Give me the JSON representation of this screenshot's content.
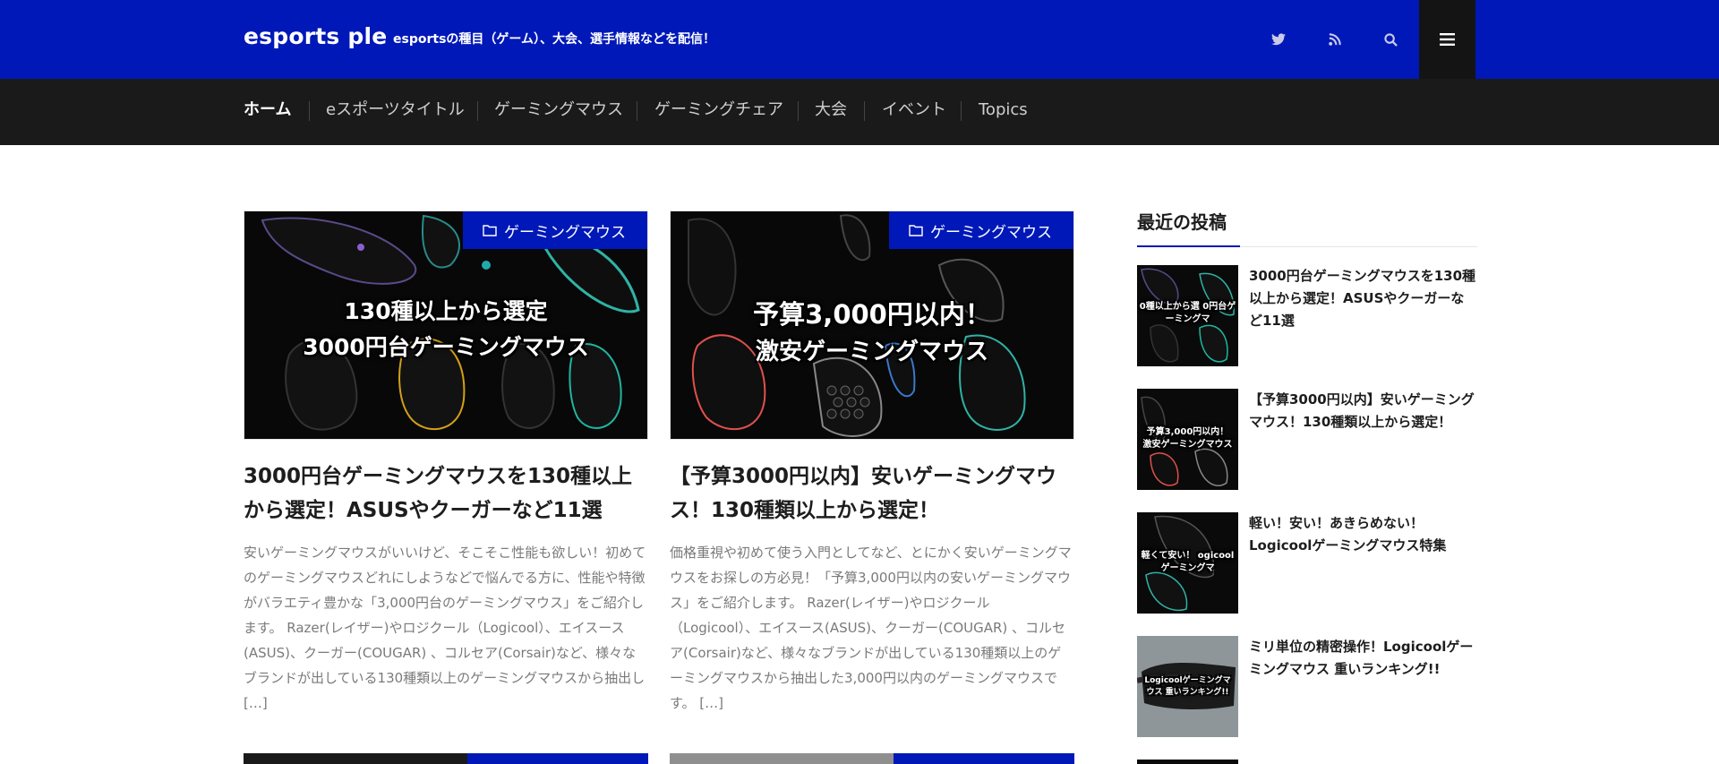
{
  "header": {
    "logo": "esports ple",
    "tagline": "esportsの種目（ゲーム）、大会、選手情報などを配信！",
    "icons": [
      "twitter-icon",
      "rss-icon",
      "search-icon",
      "menu-icon"
    ]
  },
  "nav": {
    "items": [
      {
        "label": "ホーム"
      },
      {
        "label": "eスポーツタイトル"
      },
      {
        "label": "ゲーミングマウス"
      },
      {
        "label": "ゲーミングチェア"
      },
      {
        "label": "大会"
      },
      {
        "label": "イベント"
      },
      {
        "label": "Topics"
      }
    ]
  },
  "posts": [
    {
      "category": "ゲーミングマウス",
      "thumb_lines": [
        "130種以上から選定",
        "3000円台ゲーミングマウス"
      ],
      "title": "3000円台ゲーミングマウスを130種以上から選定！ASUSやクーガーなど11選",
      "excerpt": "安いゲーミングマウスがいいけど、そこそこ性能も欲しい！初めてのゲーミングマウスどれにしようなどで悩んでる方に、性能や特徴がバラエティ豊かな「3,000円台のゲーミングマウス」をご紹介します。 Razer(レイザー)やロジクール（Logicool）、エイスース(ASUS)、クーガー(COUGAR) 、コルセア(Corsair)など、様々なブランドが出している130種類以上のゲーミングマウスから抽出し […]"
    },
    {
      "category": "ゲーミングマウス",
      "thumb_lines": [
        "予算3,000円以内！",
        "激安ゲーミングマウス"
      ],
      "title": "【予算3000円以内】安いゲーミングマウス！130種類以上から選定！",
      "excerpt": "価格重視や初めて使う入門としてなど、とにかく安いゲーミングマウスをお探しの方必見！「予算3,000円以内の安いゲーミングマウス」をご紹介します。 Razer(レイザー)やロジクール（Logicool）、エイスース(ASUS)、クーガー(COUGAR) 、コルセア(Corsair)など、様々なブランドが出している130種類以上のゲーミングマウスから抽出した3,000円以内のゲーミングマウスです。 […]"
    }
  ],
  "sidebar": {
    "title": "最近の投稿",
    "posts": [
      {
        "title": "3000円台ゲーミングマウスを130種以上から選定！ASUSやクーガーなど11選",
        "thumb_text": "0種以上から選 0円台ゲーミングマ"
      },
      {
        "title": "【予算3000円以内】安いゲーミングマウス！130種類以上から選定！",
        "thumb_text": "予算3,000円以内！ 激安ゲーミングマウス"
      },
      {
        "title": "軽い！安い！あきらめない！Logicoolゲーミングマウス特集",
        "thumb_text": "軽くて安い！ ogicoolゲーミングマ"
      },
      {
        "title": "ミリ単位の精密操作！Logicoolゲーミングマウス 重いランキング!!",
        "thumb_text": "Logicoolゲーミングマウス 重いランキング!!"
      }
    ]
  },
  "colors": {
    "brand": "#0018b8",
    "nav_bg": "#1a1a1a",
    "menu_bg": "#141414"
  }
}
